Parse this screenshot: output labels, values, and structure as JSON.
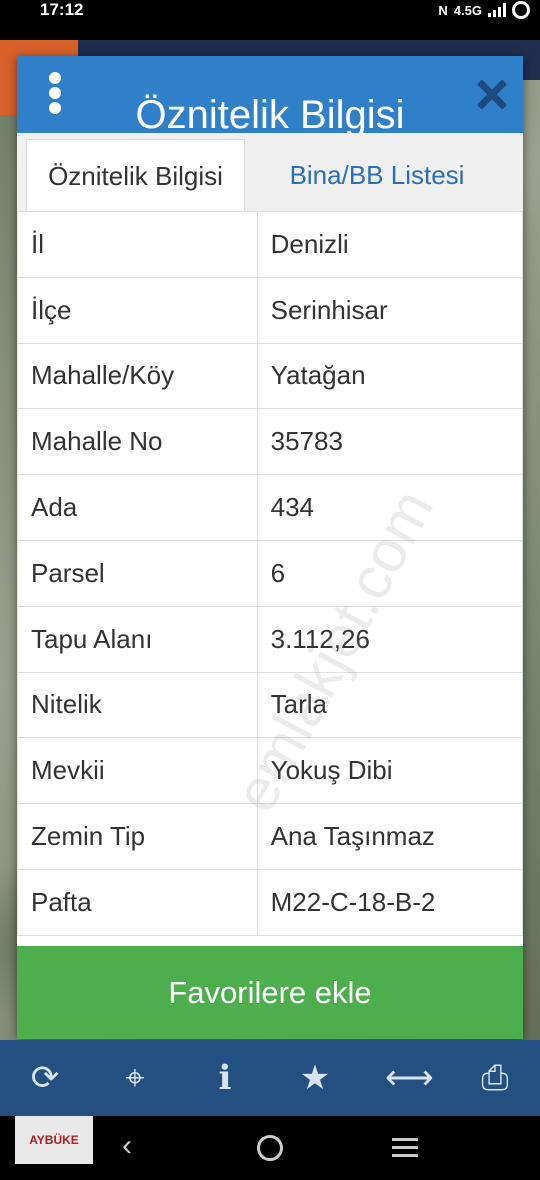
{
  "status": {
    "time": "17:12",
    "network": "4.5G"
  },
  "dialog": {
    "title": "Öznitelik Bilgisi",
    "tabs": [
      {
        "label": "Öznitelik Bilgisi",
        "active": true
      },
      {
        "label": "Bina/BB Listesi",
        "active": false
      }
    ],
    "rows": [
      {
        "key": "İl",
        "value": "Denizli"
      },
      {
        "key": "İlçe",
        "value": "Serinhisar"
      },
      {
        "key": "Mahalle/Köy",
        "value": "Yatağan"
      },
      {
        "key": "Mahalle No",
        "value": "35783"
      },
      {
        "key": "Ada",
        "value": "434"
      },
      {
        "key": "Parsel",
        "value": "6"
      },
      {
        "key": "Tapu Alanı",
        "value": "3.112,26"
      },
      {
        "key": "Nitelik",
        "value": "Tarla"
      },
      {
        "key": "Mevkii",
        "value": "Yokuş Dibi"
      },
      {
        "key": "Zemin Tip",
        "value": "Ana Taşınmaz"
      },
      {
        "key": "Pafta",
        "value": "M22-C-18-B-2"
      }
    ],
    "favorite_button": "Favorilere ekle"
  },
  "toolbar": {
    "icons": [
      "refresh-icon",
      "locate-icon",
      "info-icon",
      "star-icon",
      "measure-icon",
      "print-icon"
    ]
  },
  "watermark": "emlakjet.com",
  "brand_logo": "AYBÜKE",
  "colors": {
    "header": "#2f80c9",
    "toolbar": "#235080",
    "favorite": "#4cae4c",
    "tab_inactive_text": "#2b6fb6"
  }
}
